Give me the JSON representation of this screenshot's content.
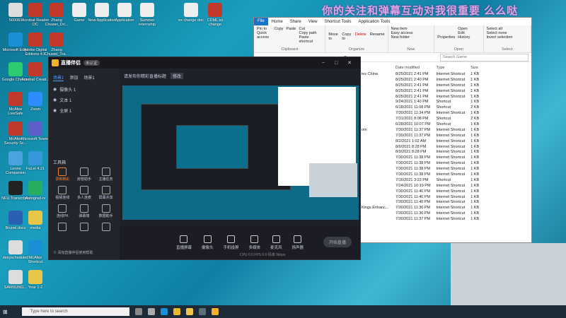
{
  "banner": "你的关注和弹幕互动对我很重要 么么哒",
  "desktop_icons": [
    "560083",
    "Acrobat Reader DC",
    "Zhang Chuwei_Dri...",
    "Game",
    "New Application",
    "Application",
    "Summer internship",
    "ex change doc",
    "CDML ex change",
    "Microsoft Edge",
    "Adobe Digital Editions 4.5",
    "Zhang Chuwei_Tra...",
    "Google Chrome",
    "Acrobat Creati...",
    "McAfee LiveSafe",
    "Zoom",
    "McAfee Security Sc...",
    "Microsoft Teams",
    "Lenne Companion",
    "FuLei 4.21",
    "NFU Transcripts",
    "Autograd-rv",
    "Brunel.docx",
    "media",
    "dexyscheduled",
    "McAfee Shortcut",
    "SAMSUNG...",
    "Year 1-2"
  ],
  "explorer": {
    "tabs": [
      "File",
      "Home",
      "Share",
      "View",
      "Shortcut Tools",
      "Application Tools"
    ],
    "ribbon": {
      "clipboard": {
        "name": "Clipboard",
        "pin": "Pin to Quick access",
        "copy": "Copy",
        "paste": "Paste",
        "cut": "Cut",
        "copy_path": "Copy path",
        "paste_shortcut": "Paste shortcut"
      },
      "organize": {
        "name": "Organize",
        "move": "Move to",
        "copy_to": "Copy to",
        "delete": "Delete",
        "rename": "Rename"
      },
      "new": {
        "name": "New",
        "new_item": "New item",
        "easy_access": "Easy access",
        "new_folder": "New folder"
      },
      "open": {
        "name": "Open",
        "properties": "Properties",
        "open": "Open",
        "edit": "Edit",
        "history": "History"
      },
      "select": {
        "name": "Select",
        "all": "Select all",
        "none": "Select none",
        "invert": "Invert selection"
      }
    },
    "search_placeholder": "Search Game",
    "columns": [
      "Date modified",
      "Type",
      "Size"
    ],
    "rows": [
      [
        "ies China",
        "8/25/2021 2:41 PM",
        "Internet Shortcut",
        "1 KB"
      ],
      [
        "",
        "8/25/2021 2:40 PM",
        "Internet Shortcut",
        "1 KB"
      ],
      [
        "",
        "8/25/2021 2:41 PM",
        "Internet Shortcut",
        "1 KB"
      ],
      [
        "",
        "8/25/2021 2:41 PM",
        "Internet Shortcut",
        "1 KB"
      ],
      [
        "",
        "8/25/2021 2:41 PM",
        "Internet Shortcut",
        "1 KB"
      ],
      [
        "",
        "9/24/2021 1:40 PM",
        "Shortcut",
        "1 KB"
      ],
      [
        "",
        "6/18/2021 11:08 PM",
        "Shortcut",
        "2 KB"
      ],
      [
        "",
        "7/30/2021 11:34 PM",
        "Internet Shortcut",
        "1 KB"
      ],
      [
        "",
        "7/31/2021 8:08 PM",
        "Shortcut",
        "2 KB"
      ],
      [
        "",
        "6/28/2021 10:07 PM",
        "Shortcut",
        "1 KB"
      ],
      [
        "om",
        "7/30/2021 11:37 PM",
        "Internet Shortcut",
        "1 KB"
      ],
      [
        "",
        "7/30/2021 11:37 PM",
        "Internet Shortcut",
        "1 KB"
      ],
      [
        "",
        "8/2/2021 1:02 AM",
        "Internet Shortcut",
        "1 KB"
      ],
      [
        "",
        "8/9/2021 8:28 PM",
        "Internet Shortcut",
        "1 KB"
      ],
      [
        "",
        "8/9/2021 8:28 PM",
        "Internet Shortcut",
        "1 KB"
      ],
      [
        "",
        "7/30/2021 11:38 PM",
        "Internet Shortcut",
        "1 KB"
      ],
      [
        "",
        "7/30/2021 11:38 PM",
        "Internet Shortcut",
        "1 KB"
      ],
      [
        "",
        "7/30/2021 11:38 PM",
        "Internet Shortcut",
        "1 KB"
      ],
      [
        "",
        "7/30/2021 11:38 PM",
        "Internet Shortcut",
        "1 KB"
      ],
      [
        "",
        "7/16/2021 3:23 PM",
        "Shortcut",
        "1 KB"
      ],
      [
        "",
        "7/24/2021 10:19 PM",
        "Internet Shortcut",
        "1 KB"
      ],
      [
        "",
        "7/30/2021 11:40 PM",
        "Internet Shortcut",
        "1 KB"
      ],
      [
        "",
        "7/30/2021 11:40 PM",
        "Internet Shortcut",
        "1 KB"
      ],
      [
        "",
        "7/30/2021 11:40 PM",
        "Internet Shortcut",
        "1 KB"
      ],
      [
        "Kings Enhanc...",
        "7/30/2021 11:36 PM",
        "Internet Shortcut",
        "1 KB"
      ],
      [
        "",
        "7/30/2021 11:36 PM",
        "Internet Shortcut",
        "1 KB"
      ],
      [
        "",
        "7/30/2021 11:37 PM",
        "Internet Shortcut",
        "1 KB"
      ]
    ]
  },
  "app": {
    "title": "直播伴侣",
    "badge": "未认证",
    "room_title": "请发布你精彩直播标题",
    "edit": "修改",
    "side_tabs": [
      "场景1",
      "添加",
      "场景1"
    ],
    "layers": [
      "摄像头 1",
      "文本 1",
      "全屏 1"
    ],
    "toolbox": "工具箱",
    "tools": [
      "录制精彩",
      "房管助手",
      "主播任务",
      "视频连线",
      "多人连麦",
      "屏幕共享",
      "连线PK",
      "弹幕墙",
      "数据助手",
      "",
      "",
      ""
    ],
    "footer_note": "※ 添加直播伴侣使用帮助",
    "bottom": [
      "直播屏幕",
      "摄像头",
      "手机投屏",
      "多媒体",
      "麦克风",
      "扬声器"
    ],
    "start_live": "开始直播",
    "stats": "CPU 0.0  FPS 0.0  码率 0kbps"
  },
  "taskbar": {
    "search_placeholder": "Type here to search"
  }
}
